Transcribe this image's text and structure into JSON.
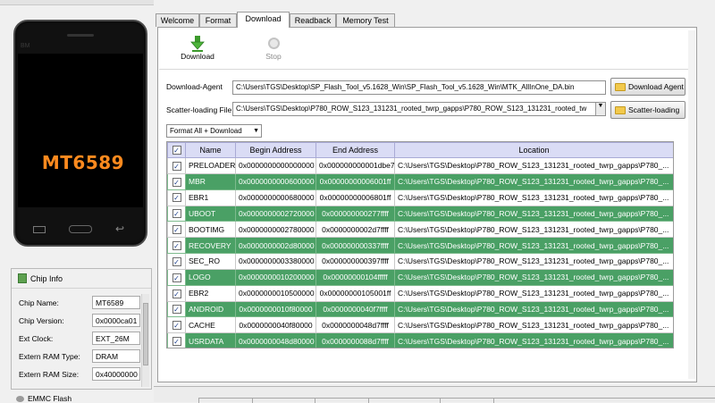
{
  "phone": {
    "brand": "BM",
    "model": "MT6589"
  },
  "chip_info": {
    "title": "Chip Info",
    "rows": [
      {
        "label": "Chip Name:",
        "value": "MT6589"
      },
      {
        "label": "Chip Version:",
        "value": "0x0000ca01"
      },
      {
        "label": "Ext Clock:",
        "value": "EXT_26M"
      },
      {
        "label": "Extern RAM Type:",
        "value": "DRAM"
      },
      {
        "label": "Extern RAM Size:",
        "value": "0x40000000"
      }
    ],
    "emmc_label": "EMMC Flash"
  },
  "tabs": [
    "Welcome",
    "Format",
    "Download",
    "Readback",
    "Memory Test"
  ],
  "active_tab": "Download",
  "toolbar": {
    "download_label": "Download",
    "stop_label": "Stop"
  },
  "download_agent": {
    "label": "Download-Agent",
    "value": "C:\\Users\\TGS\\Desktop\\SP_Flash_Tool_v5.1628_Win\\SP_Flash_Tool_v5.1628_Win\\MTK_AllInOne_DA.bin",
    "button": "Download Agent"
  },
  "scatter": {
    "label": "Scatter-loading File",
    "value": "C:\\Users\\TGS\\Desktop\\P780_ROW_S123_131231_rooted_twrp_gapps\\P780_ROW_S123_131231_rooted_tw",
    "button": "Scatter-loading"
  },
  "format_select": "Format All + Download",
  "table": {
    "columns": [
      "",
      "Name",
      "Begin Address",
      "End Address",
      "Location"
    ],
    "header_checked": "✓",
    "rows": [
      {
        "name": "PRELOADER",
        "begin": "0x0000000000000000",
        "end": "0x000000000001dbe7",
        "location": "C:\\Users\\TGS\\Desktop\\P780_ROW_S123_131231_rooted_twrp_gapps\\P780_...",
        "highlight": false
      },
      {
        "name": "MBR",
        "begin": "0x0000000000600000",
        "end": "0x00000000006001ff",
        "location": "C:\\Users\\TGS\\Desktop\\P780_ROW_S123_131231_rooted_twrp_gapps\\P780_...",
        "highlight": true
      },
      {
        "name": "EBR1",
        "begin": "0x0000000000680000",
        "end": "0x00000000006801ff",
        "location": "C:\\Users\\TGS\\Desktop\\P780_ROW_S123_131231_rooted_twrp_gapps\\P780_...",
        "highlight": false
      },
      {
        "name": "UBOOT",
        "begin": "0x0000000002720000",
        "end": "0x000000000277ffff",
        "location": "C:\\Users\\TGS\\Desktop\\P780_ROW_S123_131231_rooted_twrp_gapps\\P780_...",
        "highlight": true
      },
      {
        "name": "BOOTIMG",
        "begin": "0x0000000002780000",
        "end": "0x0000000002d7ffff",
        "location": "C:\\Users\\TGS\\Desktop\\P780_ROW_S123_131231_rooted_twrp_gapps\\P780_...",
        "highlight": false
      },
      {
        "name": "RECOVERY",
        "begin": "0x0000000002d80000",
        "end": "0x000000000337ffff",
        "location": "C:\\Users\\TGS\\Desktop\\P780_ROW_S123_131231_rooted_twrp_gapps\\P780_...",
        "highlight": true
      },
      {
        "name": "SEC_RO",
        "begin": "0x0000000003380000",
        "end": "0x000000000397ffff",
        "location": "C:\\Users\\TGS\\Desktop\\P780_ROW_S123_131231_rooted_twrp_gapps\\P780_...",
        "highlight": false
      },
      {
        "name": "LOGO",
        "begin": "0x0000000010200000",
        "end": "0x00000000104fffff",
        "location": "C:\\Users\\TGS\\Desktop\\P780_ROW_S123_131231_rooted_twrp_gapps\\P780_...",
        "highlight": true
      },
      {
        "name": "EBR2",
        "begin": "0x0000000010500000",
        "end": "0x00000000105001ff",
        "location": "C:\\Users\\TGS\\Desktop\\P780_ROW_S123_131231_rooted_twrp_gapps\\P780_...",
        "highlight": false
      },
      {
        "name": "ANDROID",
        "begin": "0x0000000010f80000",
        "end": "0x0000000040f7ffff",
        "location": "C:\\Users\\TGS\\Desktop\\P780_ROW_S123_131231_rooted_twrp_gapps\\P780_...",
        "highlight": true
      },
      {
        "name": "CACHE",
        "begin": "0x0000000040f80000",
        "end": "0x0000000048d7ffff",
        "location": "C:\\Users\\TGS\\Desktop\\P780_ROW_S123_131231_rooted_twrp_gapps\\P780_...",
        "highlight": false
      },
      {
        "name": "USRDATA",
        "begin": "0x0000000048d80000",
        "end": "0x0000000088d7ffff",
        "location": "C:\\Users\\TGS\\Desktop\\P780_ROW_S123_131231_rooted_twrp_gapps\\P780_...",
        "highlight": true
      }
    ]
  },
  "colors": {
    "highlight_row": "#4aa065",
    "table_header": "#dadcf5",
    "chip_model": "#ff8a1e"
  }
}
